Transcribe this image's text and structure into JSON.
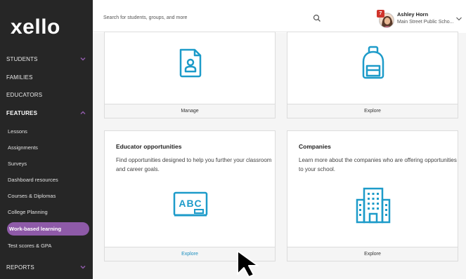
{
  "brand": {
    "logo_text": "xello",
    "accent_green": "#8bc53f",
    "active_purple": "#8e5aa8",
    "link_blue": "#1d8fbf"
  },
  "sidebar": {
    "items": [
      {
        "label": "STUDENTS",
        "expanded": false
      },
      {
        "label": "FAMILIES"
      },
      {
        "label": "EDUCATORS"
      },
      {
        "label": "FEATURES",
        "expanded": true
      }
    ],
    "features_sub": [
      {
        "label": "Lessons"
      },
      {
        "label": "Assignments"
      },
      {
        "label": "Surveys"
      },
      {
        "label": "Dashboard resources"
      },
      {
        "label": "Courses & Diplomas"
      },
      {
        "label": "College Planning"
      },
      {
        "label": "Work-based learning",
        "active": true
      },
      {
        "label": "Test scores & GPA"
      }
    ],
    "reports": {
      "label": "REPORTS"
    }
  },
  "header": {
    "search_placeholder": "Search for students, groups, and more",
    "notification_count": "7",
    "user_name": "Ashley Horn",
    "user_school": "Main Street Public Scho..."
  },
  "cards": [
    {
      "icon": "profile-document-icon",
      "footer": "Manage"
    },
    {
      "icon": "backpack-icon",
      "footer": "Explore"
    },
    {
      "title": "Educator opportunities",
      "desc": "Find opportunities designed to help you further your classroom and career goals.",
      "icon": "chalkboard-abc-icon",
      "footer": "Explore"
    },
    {
      "title": "Companies",
      "desc": "Learn more about the companies who are offering opportunities to your school.",
      "icon": "building-icon",
      "footer": "Explore"
    }
  ]
}
